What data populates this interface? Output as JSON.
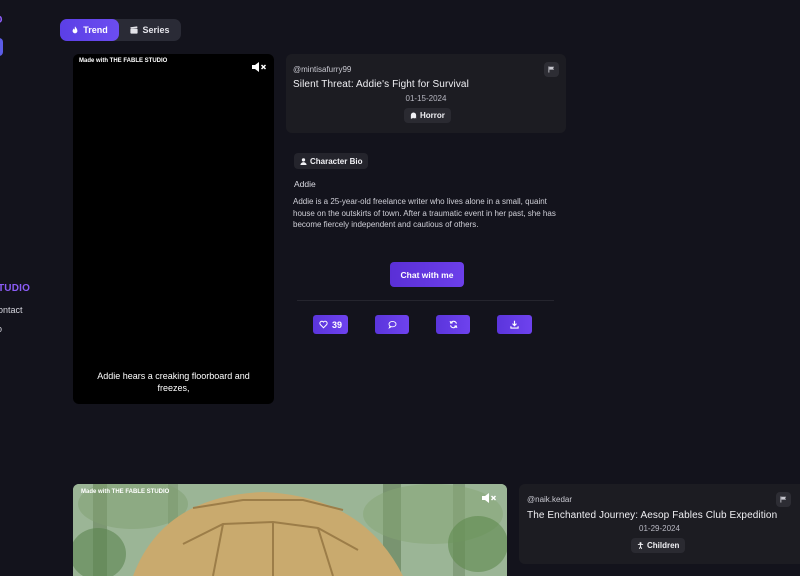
{
  "sidebar": {
    "logo_fragment": "O",
    "studio_label": "TUDIO",
    "contact_label": "ontact",
    "about_label": "o"
  },
  "tabs": [
    {
      "label": "Trend",
      "icon": "flame-icon",
      "active": true
    },
    {
      "label": "Series",
      "icon": "clapperboard-icon",
      "active": false
    }
  ],
  "post1": {
    "watermark": "Made with THE FABLE STUDIO",
    "caption": "Addie hears a creaking floorboard and freezes,",
    "author": "@mintisafurry99",
    "title": "Silent Threat: Addie's Fight for Survival",
    "date": "01-15-2024",
    "genre": "Horror",
    "genre_icon": "ghost-icon",
    "bio_label": "Character Bio",
    "character_name": "Addie",
    "bio": "Addie is a 25-year-old freelance writer who lives alone in a small, quaint house on the outskirts of town. After a traumatic event in her past, she has become fiercely independent and cautious of others.",
    "chat_label": "Chat with me",
    "likes": "39"
  },
  "post2": {
    "watermark": "Made with THE FABLE STUDIO",
    "author": "@naik.kedar",
    "title": "The Enchanted Journey: Aesop Fables Club Expedition",
    "date": "01-29-2024",
    "genre": "Children",
    "genre_icon": "child-icon"
  },
  "colors": {
    "background": "#13131c",
    "accent": "#6c42ee",
    "card": "#1c1c22",
    "sidebar_accent": "#8b5cf6"
  }
}
